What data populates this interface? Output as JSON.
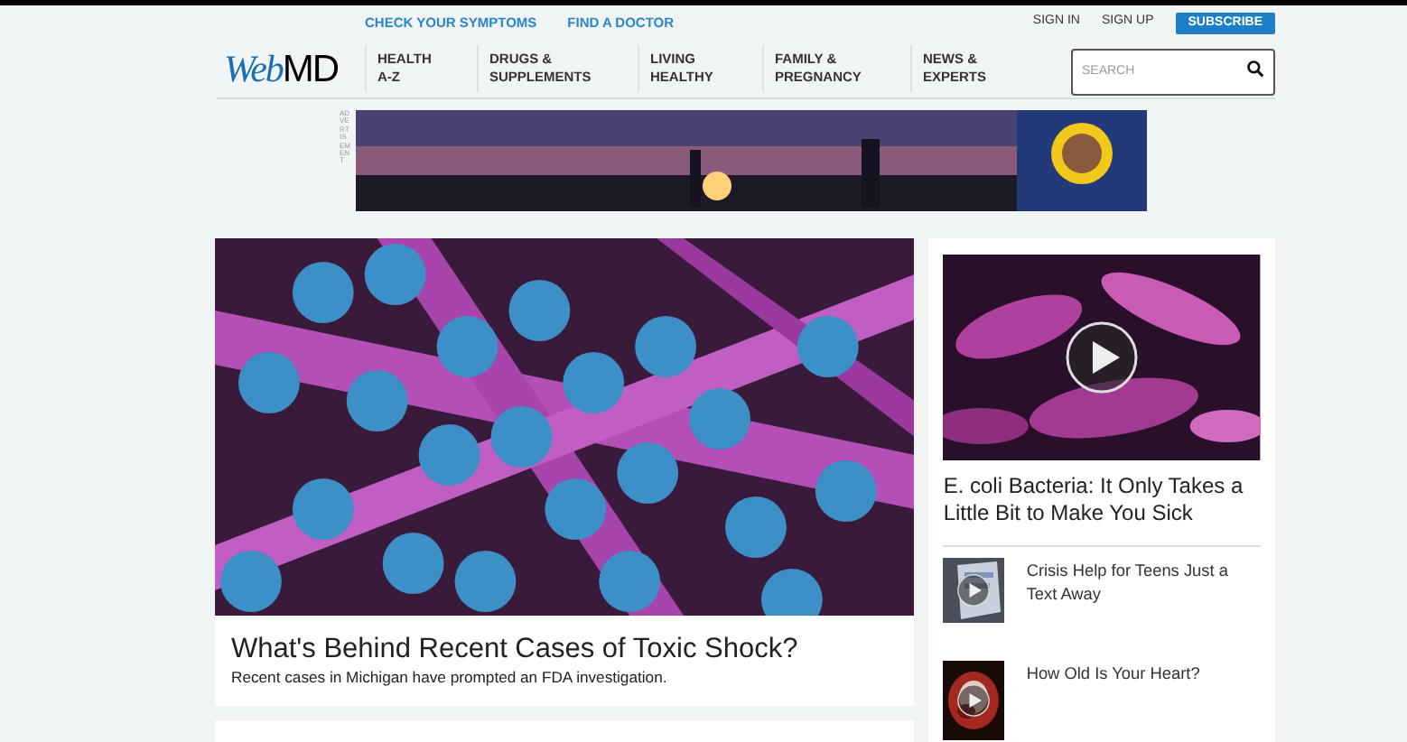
{
  "top_links": [
    "CHECK YOUR SYMPTOMS",
    "FIND A DOCTOR"
  ],
  "account": {
    "sign_in": "SIGN IN",
    "sign_up": "SIGN UP",
    "subscribe": "SUBSCRIBE"
  },
  "logo": {
    "web": "Web",
    "md": "MD"
  },
  "nav": [
    {
      "line1": "HEALTH",
      "line2": "A-Z"
    },
    {
      "line1": "DRUGS &",
      "line2": "SUPPLEMENTS"
    },
    {
      "line1": "LIVING",
      "line2": "HEALTHY"
    },
    {
      "line1": "FAMILY &",
      "line2": "PREGNANCY"
    },
    {
      "line1": "NEWS &",
      "line2": "EXPERTS"
    }
  ],
  "search": {
    "placeholder": "SEARCH"
  },
  "ad": {
    "label": "ADVERTISEMENT",
    "kind": "picture"
  },
  "main_story": {
    "title": "What's Behind Recent Cases of Toxic Shock?",
    "summary": "Recent cases in Michigan have prompted an FDA investigation."
  },
  "feature": {
    "title": "E. coli Bacteria: It Only Takes a Little Bit to Make You Sick",
    "video": true
  },
  "side_stories": [
    {
      "title": "Crisis Help for Teens Just a Text Away",
      "video": true
    },
    {
      "title": "How Old Is Your Heart?",
      "video": true
    }
  ]
}
